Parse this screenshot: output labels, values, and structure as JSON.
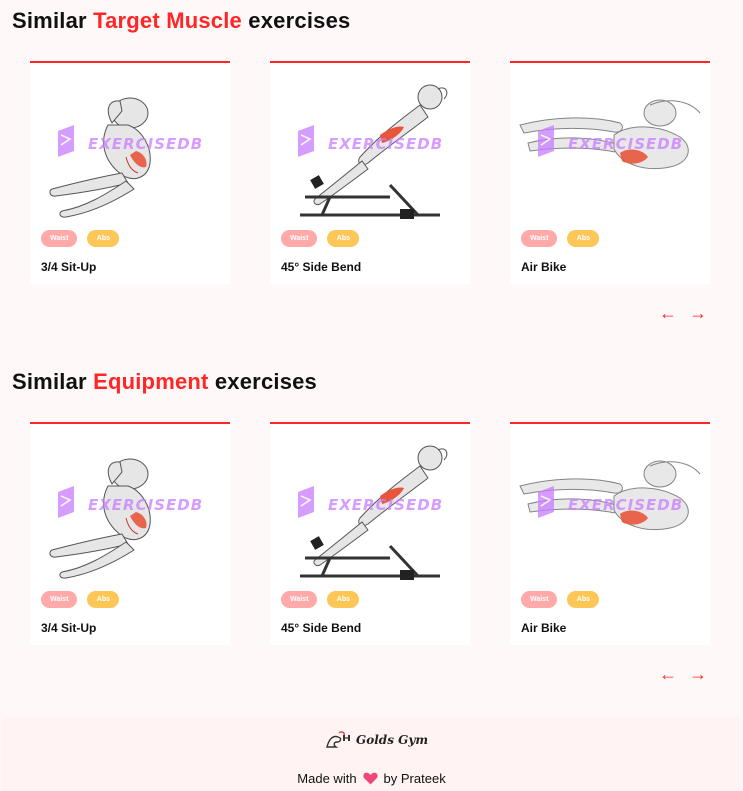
{
  "sections": [
    {
      "title_prefix": "Similar ",
      "title_accent": "Target Muscle",
      "title_suffix": " exercises",
      "cards": [
        {
          "name": "3/4 Sit-Up",
          "tags": [
            "Waist",
            "Abs"
          ],
          "image": "situp-figure",
          "watermark": "EXERCISEDB"
        },
        {
          "name": "45° Side Bend",
          "tags": [
            "Waist",
            "Abs"
          ],
          "image": "side-bend-figure",
          "watermark": "EXERCISEDB"
        },
        {
          "name": "Air Bike",
          "tags": [
            "Waist",
            "Abs"
          ],
          "image": "air-bike-figure",
          "watermark": "EXERCISEDB"
        }
      ],
      "prev_arrow": "←",
      "next_arrow": "→"
    },
    {
      "title_prefix": "Similar ",
      "title_accent": "Equipment",
      "title_suffix": " exercises",
      "cards": [
        {
          "name": "3/4 Sit-Up",
          "tags": [
            "Waist",
            "Abs"
          ],
          "image": "situp-figure",
          "watermark": "EXERCISEDB"
        },
        {
          "name": "45° Side Bend",
          "tags": [
            "Waist",
            "Abs"
          ],
          "image": "side-bend-figure",
          "watermark": "EXERCISEDB"
        },
        {
          "name": "Air Bike",
          "tags": [
            "Waist",
            "Abs"
          ],
          "image": "air-bike-figure",
          "watermark": "EXERCISEDB"
        }
      ],
      "prev_arrow": "←",
      "next_arrow": "→"
    }
  ],
  "footer": {
    "brand": "Golds Gym",
    "made_prefix": "Made with",
    "heart_icon": "heart-icon",
    "made_suffix": "by Prateek"
  },
  "colors": {
    "accent": "#ff2625",
    "tag_pink": "#ffa9a9",
    "tag_yellow": "#fcc757",
    "background": "#fff8f8",
    "watermark": "#c77dff"
  }
}
